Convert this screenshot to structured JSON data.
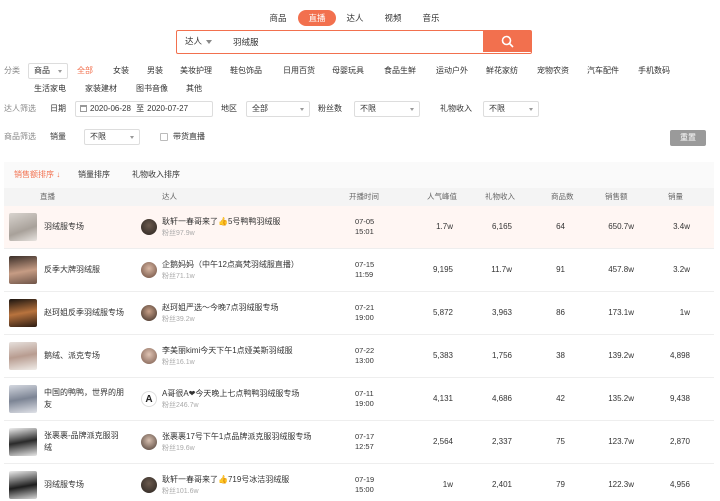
{
  "top_tabs": [
    "商品",
    "直播",
    "达人",
    "视频",
    "音乐"
  ],
  "search": {
    "type": "达人",
    "value": "羽绒服"
  },
  "filters": {
    "category_label": "分类",
    "category_type": "商品",
    "categories_row1": [
      "全部",
      "女装",
      "男装",
      "美妆护理",
      "鞋包饰品",
      "日用百货",
      "母婴玩具",
      "食品生鲜",
      "运动户外",
      "鲜花家纺",
      "宠物农资",
      "汽车配件",
      "手机数码"
    ],
    "categories_row2": [
      "生活家电",
      "家装建材",
      "图书音像",
      "其他"
    ],
    "expert_label": "达人筛选",
    "date_label": "日期",
    "date_start": "2020-06-28",
    "date_sep": "至",
    "date_end": "2020-07-27",
    "region_label": "地区",
    "region_value": "全部",
    "fans_label": "粉丝数",
    "fans_value": "不限",
    "gift_label": "礼物收入",
    "gift_value": "不限",
    "product_label": "商品筛选",
    "sales_label": "销量",
    "sales_value": "不限",
    "live_goods_label": "带货直播",
    "reset": "重置"
  },
  "sort_tabs": [
    "销售额排序 ↓",
    "销量排序",
    "礼物收入排序"
  ],
  "columns": [
    "直播",
    "达人",
    "开播时间",
    "人气峰值",
    "礼物收入",
    "商品数",
    "销售额",
    "销量"
  ],
  "rows": [
    {
      "title": "羽绒服专场",
      "name": "耿轩一春哥来了👍5号鸭鸭羽绒服",
      "fans": "粉丝97.9w",
      "time": "07-05\n15:01",
      "peak": "1.7w",
      "gift": "6,165",
      "items": "64",
      "revenue": "650.7w",
      "sales": "3.4w"
    },
    {
      "title": "反季大牌羽绒服",
      "name": "企鹅妈妈（中午12点高梵羽绒服直播）",
      "fans": "粉丝71.1w",
      "time": "07-15\n11:59",
      "peak": "9,195",
      "gift": "11.7w",
      "items": "91",
      "revenue": "457.8w",
      "sales": "3.2w"
    },
    {
      "title": "赵珂姐反季羽绒服专场",
      "name": "赵珂姐严选～今晚7点羽绒服专场",
      "fans": "粉丝39.2w",
      "time": "07-21\n19:00",
      "peak": "5,872",
      "gift": "3,963",
      "items": "86",
      "revenue": "173.1w",
      "sales": "1w"
    },
    {
      "title": "鹅绒、派克专场",
      "name": "李美丽kimi今天下午1点娅美斯羽绒服",
      "fans": "粉丝16.1w",
      "time": "07-22\n13:00",
      "peak": "5,383",
      "gift": "1,756",
      "items": "38",
      "revenue": "139.2w",
      "sales": "4,898"
    },
    {
      "title": "中国的鸭鸭，世界的朋\n友",
      "name": "A哥很A❤今天晚上七点鸭鸭羽绒服专场",
      "fans": "粉丝246.7w",
      "time": "07-11\n19:00",
      "peak": "4,131",
      "gift": "4,686",
      "items": "42",
      "revenue": "135.2w",
      "sales": "9,438"
    },
    {
      "title": "张裹裹-品牌派克服羽\n绒",
      "name": "张裹裹17号下午1点品牌派克服羽绒服专场",
      "fans": "粉丝19.6w",
      "time": "07-17\n12:57",
      "peak": "2,564",
      "gift": "2,337",
      "items": "75",
      "revenue": "123.7w",
      "sales": "2,870"
    },
    {
      "title": "羽绒服专场",
      "name": "耿轩一春哥来了👍719号冰洁羽绒服",
      "fans": "粉丝101.6w",
      "time": "07-19\n15:00",
      "peak": "1w",
      "gift": "2,401",
      "items": "79",
      "revenue": "122.3w",
      "sales": "4,956"
    }
  ],
  "colors": {
    "accent": "#f2704e",
    "highlight_row": "#fff6f3"
  }
}
